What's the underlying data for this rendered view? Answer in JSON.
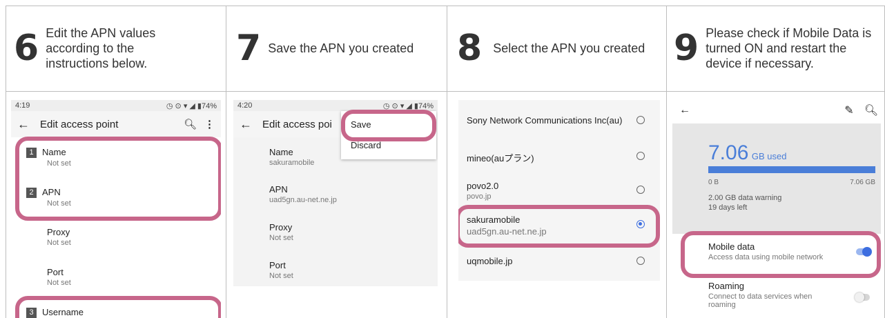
{
  "steps": [
    {
      "number": "6",
      "text": "Edit the APN values according to the instructions below."
    },
    {
      "number": "7",
      "text": "Save the APN you created"
    },
    {
      "number": "8",
      "text": "Select the APN you created"
    },
    {
      "number": "9",
      "text": "Please check if Mobile Data is turned ON and restart the device if necessary."
    }
  ],
  "screen6": {
    "time": "4:19",
    "battery": "74%",
    "title": "Edit access point",
    "fields": [
      {
        "badge": "1",
        "label": "Name",
        "value": "Not set"
      },
      {
        "badge": "2",
        "label": "APN",
        "value": "Not set"
      },
      {
        "badge": "",
        "label": "Proxy",
        "value": "Not set"
      },
      {
        "badge": "",
        "label": "Port",
        "value": "Not set"
      },
      {
        "badge": "3",
        "label": "Username",
        "value": ""
      }
    ]
  },
  "screen7": {
    "time": "4:20",
    "battery": "74%",
    "title": "Edit access poi",
    "menu": {
      "save": "Save",
      "discard": "Discard"
    },
    "fields": [
      {
        "label": "Name",
        "value": "sakuramobile"
      },
      {
        "label": "APN",
        "value": "uad5gn.au-net.ne.jp"
      },
      {
        "label": "Proxy",
        "value": "Not set"
      },
      {
        "label": "Port",
        "value": "Not set"
      }
    ]
  },
  "screen8": {
    "apns": [
      {
        "name": "Sony Network Communications Inc(au)",
        "detail": "",
        "selected": false
      },
      {
        "name": "mineo(auプラン)",
        "detail": "",
        "selected": false
      },
      {
        "name": "povo2.0",
        "detail": "povo.jp",
        "selected": false
      },
      {
        "name": "sakuramobile",
        "detail": "uad5gn.au-net.ne.jp",
        "selected": true
      },
      {
        "name": "uqmobile.jp",
        "detail": "",
        "selected": false
      }
    ]
  },
  "screen9": {
    "used_value": "7.06",
    "used_unit": "GB used",
    "bar_min": "0 B",
    "bar_max": "7.06 GB",
    "bar_fill": 1.0,
    "warning": "2.00 GB data warning",
    "days_left": "19 days left",
    "mobile_data": {
      "label": "Mobile data",
      "desc": "Access data using mobile network",
      "on": true
    },
    "roaming": {
      "label": "Roaming",
      "desc": "Connect to data services when roaming",
      "on": false
    }
  },
  "colors": {
    "highlight": "#c7668a",
    "accent": "#3d6ee0",
    "bar": "#4a7ed8"
  }
}
